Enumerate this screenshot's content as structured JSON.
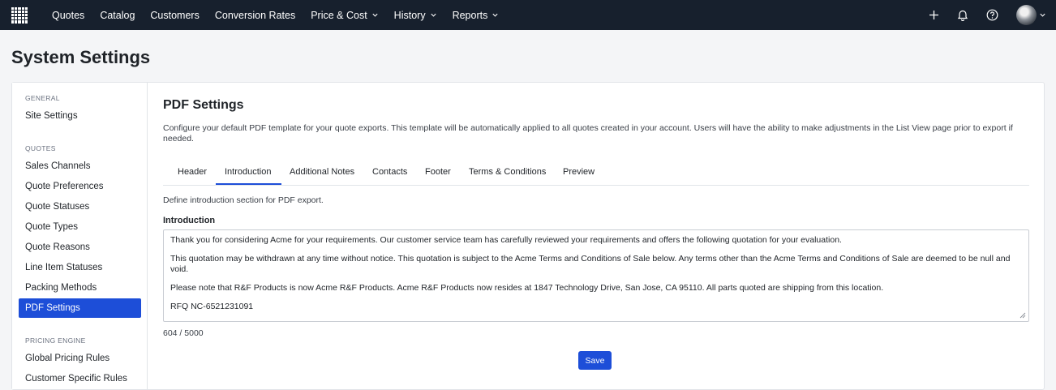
{
  "nav": {
    "items": [
      {
        "label": "Quotes",
        "dropdown": false
      },
      {
        "label": "Catalog",
        "dropdown": false
      },
      {
        "label": "Customers",
        "dropdown": false
      },
      {
        "label": "Conversion Rates",
        "dropdown": false
      },
      {
        "label": "Price & Cost",
        "dropdown": true
      },
      {
        "label": "History",
        "dropdown": true
      },
      {
        "label": "Reports",
        "dropdown": true
      }
    ],
    "right_icons": [
      "plus-icon",
      "bell-icon",
      "help-icon"
    ]
  },
  "page": {
    "title": "System Settings"
  },
  "sidebar": {
    "general_heading": "GENERAL",
    "general_items": [
      "Site Settings"
    ],
    "quotes_heading": "QUOTES",
    "quotes_items": [
      "Sales Channels",
      "Quote Preferences",
      "Quote Statuses",
      "Quote Types",
      "Quote Reasons",
      "Line Item Statuses",
      "Packing Methods",
      "PDF Settings"
    ],
    "active_item": "PDF Settings",
    "pricing_heading": "PRICING ENGINE",
    "pricing_items": [
      "Global Pricing Rules",
      "Customer Specific Rules"
    ]
  },
  "content": {
    "title": "PDF Settings",
    "description": "Configure your default PDF template for your quote exports. This template will be automatically applied to all quotes created in your account. Users will have the ability to make adjustments in the List View page prior to export if needed.",
    "tabs": [
      "Header",
      "Introduction",
      "Additional Notes",
      "Contacts",
      "Footer",
      "Terms & Conditions",
      "Preview"
    ],
    "active_tab": "Introduction",
    "section_description": "Define introduction section for PDF export.",
    "field_label": "Introduction",
    "paragraphs": [
      "Thank you for considering Acme for your requirements. Our customer service team has carefully reviewed your requirements and offers the following quotation for your evaluation.",
      "This quotation may be withdrawn at any time without notice. This quotation is subject to the Acme Terms and Conditions of Sale below. Any terms other than the Acme Terms and Conditions of Sale are deemed to be null and void.",
      "Please note that R&F Products is now Acme R&F Products. Acme R&F Products now resides at 1847 Technology Drive, San Jose, CA 95110. All parts quoted are shipping from this location.",
      "RFQ NC-6521231091"
    ],
    "char_count": "604 / 5000",
    "save_label": "Save"
  },
  "colors": {
    "topbar": "#17202d",
    "accent": "#1d4ed8"
  }
}
